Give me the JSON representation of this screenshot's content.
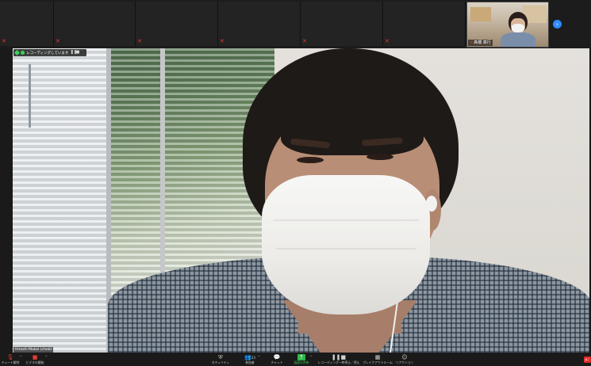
{
  "gallery": {
    "self_view": {
      "name": "髙橋 真行"
    },
    "next_page_icon": "chevron-right-icon"
  },
  "speaker": {
    "recording_label": "レコーディングしています",
    "name": "Hiroshi Mukai (cheb)"
  },
  "toolbar": {
    "mute_label": "ミュート解除",
    "video_label": "ビデオの開始",
    "security_label": "セキュリティ",
    "participants_label": "参加者",
    "participants_count": "23",
    "chat_label": "チャット",
    "share_label": "画面の共有",
    "record_label": "レコーディング一時停止／停止",
    "breakout_label": "ブレイクアウトルーム",
    "reactions_label": "リアクション",
    "end_label": "終了"
  },
  "colors": {
    "share_green": "#2fb74a",
    "muted_red": "#e03a3a",
    "accent_blue": "#2d8cff"
  }
}
